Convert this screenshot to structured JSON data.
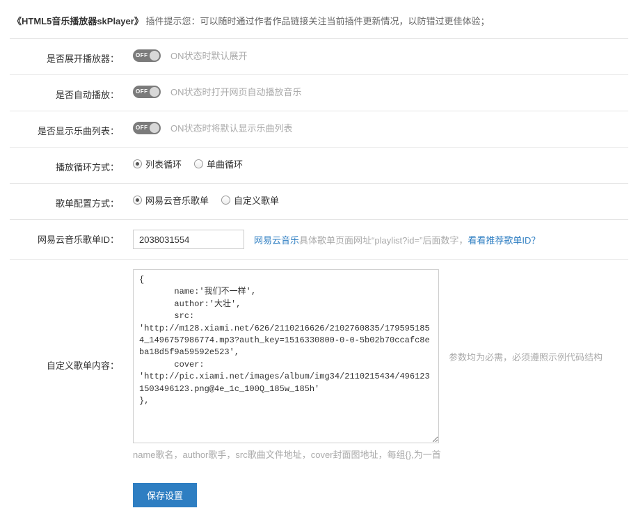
{
  "header": {
    "plugin_name": "《HTML5音乐播放器skPlayer》",
    "tip_text": "插件提示您：可以随时通过作者作品链接关注当前插件更新情况，以防错过更佳体验；"
  },
  "rows": {
    "expand": {
      "label": "是否展开播放器：",
      "toggle_text": "OFF",
      "hint": "ON状态时默认展开"
    },
    "autoplay": {
      "label": "是否自动播放：",
      "toggle_text": "OFF",
      "hint": "ON状态时打开网页自动播放音乐"
    },
    "showlist": {
      "label": "是否显示乐曲列表：",
      "toggle_text": "OFF",
      "hint": "ON状态时将默认显示乐曲列表"
    },
    "loop": {
      "label": "播放循环方式：",
      "opt1": "列表循环",
      "opt2": "单曲循环"
    },
    "source": {
      "label": "歌单配置方式：",
      "opt1": "网易云音乐歌单",
      "opt2": "自定义歌单"
    },
    "playlist_id": {
      "label": "网易云音乐歌单ID：",
      "value": "2038031554",
      "link1": "网易云音乐",
      "desc_mid": "具体歌单页面网址“playlist?id=”后面数字，",
      "link2": "看看推荐歌单ID？"
    },
    "custom": {
      "label": "自定义歌单内容：",
      "textarea_value": "{\n       name:'我们不一样',\n       author:'大壮',\n       src:\n'http://m128.xiami.net/626/2110216626/2102760835/1795951854_1496757986774.mp3?auth_key=1516330800-0-0-5b02b70ccafc8eba18d5f9a59592e523',\n       cover:\n'http://pic.xiami.net/images/album/img34/2110215434/4961231503496123.png@4e_1c_100Q_185w_185h'\n},",
      "side_hint": "参数均为必需，必须遵照示例代码结构",
      "under_hint": "name歌名，author歌手，src歌曲文件地址，cover封面图地址，每组{},为一首"
    }
  },
  "buttons": {
    "save": "保存设置"
  }
}
